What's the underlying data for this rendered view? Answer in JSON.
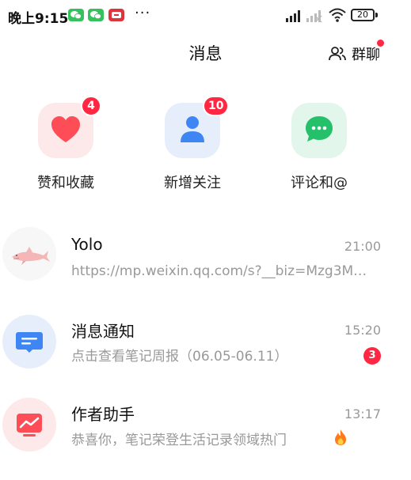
{
  "status_bar": {
    "time": "晚上9:15",
    "more": "···",
    "battery": "20"
  },
  "header": {
    "title": "消息",
    "group_chat_label": "群聊"
  },
  "categories": [
    {
      "label": "赞和收藏",
      "badge": "4",
      "icon": "heart-icon",
      "color": "#ff4d57"
    },
    {
      "label": "新增关注",
      "badge": "10",
      "icon": "person-icon",
      "color": "#3f86f5"
    },
    {
      "label": "评论和@",
      "badge": "",
      "icon": "comment-icon",
      "color": "#24c06a"
    }
  ],
  "messages": [
    {
      "name": "Yolo",
      "time": "21:00",
      "preview": "https://mp.weixin.qq.com/s?__biz=Mzg3M…",
      "badge": "",
      "avatar": "shark-avatar"
    },
    {
      "name": "消息通知",
      "time": "15:20",
      "preview": "点击查看笔记周报（06.05-06.11）",
      "badge": "3",
      "avatar": "notification-icon"
    },
    {
      "name": "作者助手",
      "time": "13:17",
      "preview": "恭喜你，笔记荣登生活记录领域热门",
      "badge": "",
      "avatar": "trend-chart-icon"
    }
  ],
  "colors": {
    "badge_red": "#ff2741",
    "wechat_green": "#35c15b"
  }
}
